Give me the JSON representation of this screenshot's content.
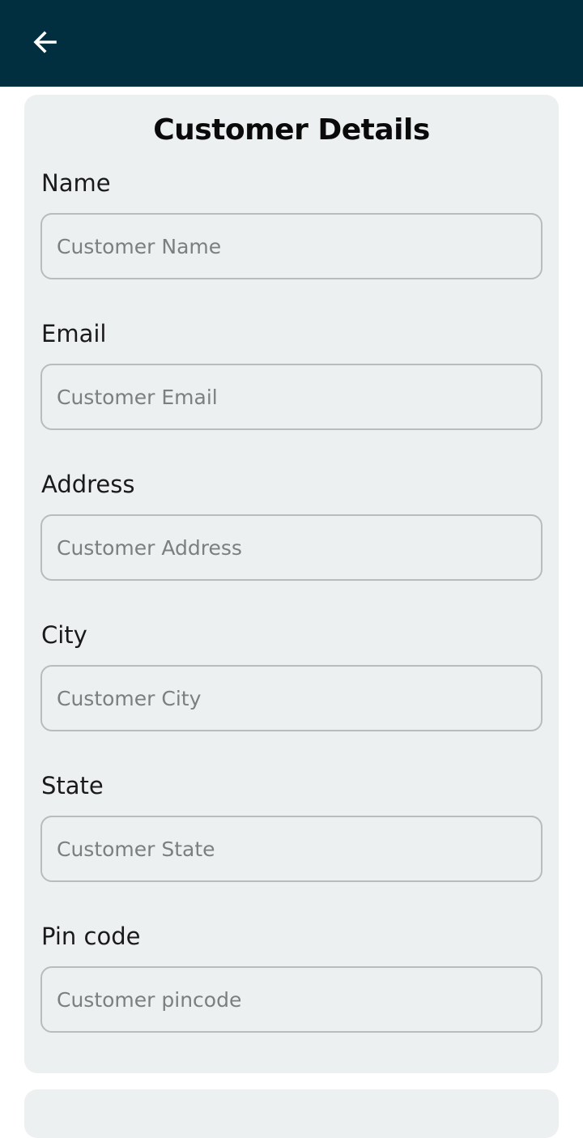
{
  "header": {
    "back_icon": "arrow-left-icon",
    "background_color": "#022f3f"
  },
  "form": {
    "title": "Customer Details",
    "fields": [
      {
        "label": "Name",
        "placeholder": "Customer Name"
      },
      {
        "label": "Email",
        "placeholder": "Customer Email"
      },
      {
        "label": "Address",
        "placeholder": "Customer Address"
      },
      {
        "label": "City",
        "placeholder": "Customer City"
      },
      {
        "label": "State",
        "placeholder": "Customer State"
      },
      {
        "label": "Pin code",
        "placeholder": "Customer pincode"
      }
    ]
  }
}
